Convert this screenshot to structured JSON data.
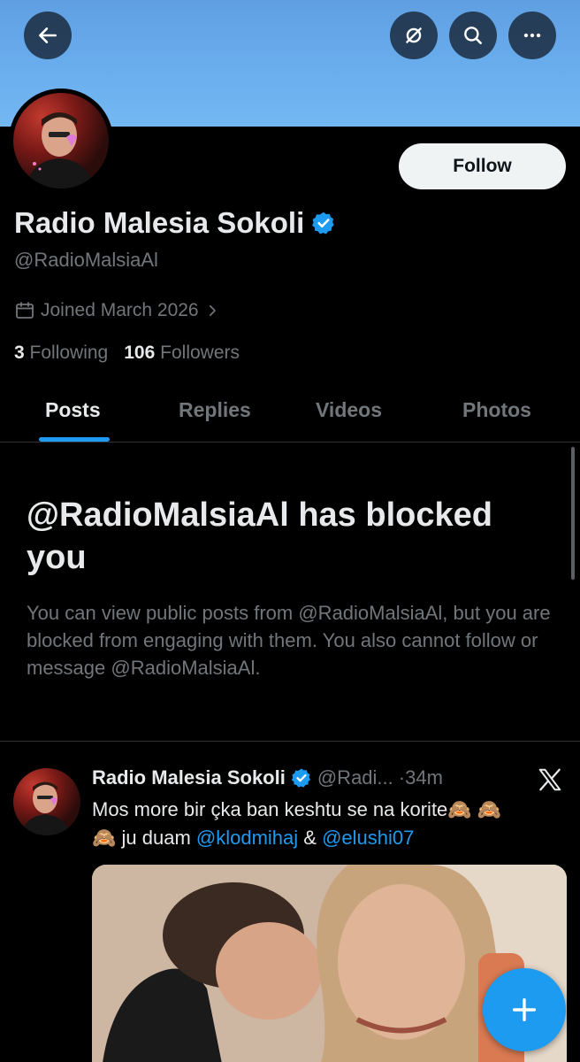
{
  "header": {
    "back_icon": "arrow-left-icon",
    "actions": [
      "hide-reposts-icon",
      "search-icon",
      "more-icon"
    ]
  },
  "profile": {
    "display_name": "Radio Malesia Sokoli",
    "verified": true,
    "handle": "@RadioMalsiaAl",
    "joined": "Joined March 2026",
    "following_count": "3",
    "following_label": "Following",
    "followers_count": "106",
    "followers_label": "Followers",
    "follow_label": "Follow"
  },
  "tabs": [
    {
      "label": "Posts",
      "active": true
    },
    {
      "label": "Replies",
      "active": false
    },
    {
      "label": "Videos",
      "active": false
    },
    {
      "label": "Photos",
      "active": false
    }
  ],
  "blocked": {
    "title": "@RadioMalsiaAl has blocked you",
    "description": "You can view public posts from @RadioMalsiaAl, but you are blocked from engaging with them. You also cannot follow or message @RadioMalsiaAl."
  },
  "post": {
    "author": "Radio Malesia Sokoli",
    "handle": "@Radi...",
    "time": "·34m",
    "text_part1": "Mos more bir çka ban keshtu se na korite",
    "emoji": "🙈",
    "text_part2": " ju duam ",
    "mention1": "@klodmihaj",
    "text_part3": " & ",
    "mention2": "@elushi07"
  },
  "colors": {
    "accent": "#1d9bf0",
    "banner": "#6aaeee",
    "background": "#000000"
  }
}
